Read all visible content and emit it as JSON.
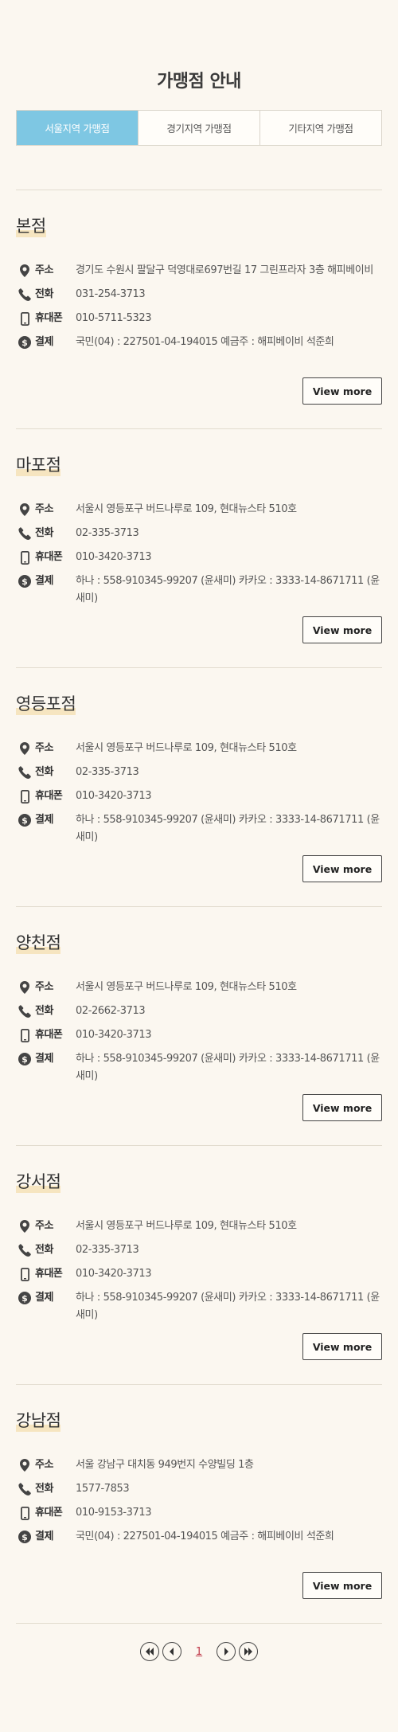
{
  "page_title": "가맹점 안내",
  "tabs": [
    {
      "label": "서울지역 가맹점",
      "active": true
    },
    {
      "label": "경기지역 가맹점",
      "active": false
    },
    {
      "label": "기타지역 가맹점",
      "active": false
    }
  ],
  "labels": {
    "address": "주소",
    "phone": "전화",
    "mobile": "휴대폰",
    "payment": "결제",
    "view_more": "View more"
  },
  "stores": [
    {
      "name": "본점",
      "address": "경기도 수원시 팔달구 덕영대로697번길 17 그린프라자 3층 해피베이비",
      "phone": "031-254-3713",
      "mobile": "010-5711-5323",
      "payment": "국민(04) : 227501-04-194015 예금주 : 해피베이비 석준희"
    },
    {
      "name": "마포점",
      "address": "서울시 영등포구 버드나루로 109, 현대뉴스타 510호",
      "phone": "02-335-3713",
      "mobile": "010-3420-3713",
      "payment": "하나 : 558-910345-99207 (윤새미) 카카오 : 3333-14-8671711 (윤새미)"
    },
    {
      "name": "영등포점",
      "address": "서울시 영등포구 버드나루로 109, 현대뉴스타 510호",
      "phone": "02-335-3713",
      "mobile": "010-3420-3713",
      "payment": "하나 : 558-910345-99207 (윤새미) 카카오 : 3333-14-8671711 (윤새미)"
    },
    {
      "name": "양천점",
      "address": "서울시 영등포구 버드나루로 109, 현대뉴스타 510호",
      "phone": "02-2662-3713",
      "mobile": "010-3420-3713",
      "payment": "하나 : 558-910345-99207 (윤새미) 카카오 : 3333-14-8671711 (윤새미)"
    },
    {
      "name": "강서점",
      "address": "서울시 영등포구 버드나루로 109, 현대뉴스타 510호",
      "phone": "02-335-3713",
      "mobile": "010-3420-3713",
      "payment": "하나 : 558-910345-99207 (윤새미) 카카오 : 3333-14-8671711 (윤새미)"
    },
    {
      "name": "강남점",
      "address": "서울 강남구 대치동 949번지 수양빌딩 1층",
      "phone": "1577-7853",
      "mobile": "010-9153-3713",
      "payment": "국민(04) : 227501-04-194015 예금주 : 해피베이비 석준희"
    }
  ],
  "pagination": {
    "current_page": "1",
    "icons": [
      "first-page-icon",
      "prev-page-icon",
      "next-page-icon",
      "last-page-icon"
    ]
  },
  "colors": {
    "background": "#fbf7f0",
    "active_tab": "#7ec7e3",
    "name_highlight": "#f4dfb0",
    "current_page": "#c0394a"
  }
}
